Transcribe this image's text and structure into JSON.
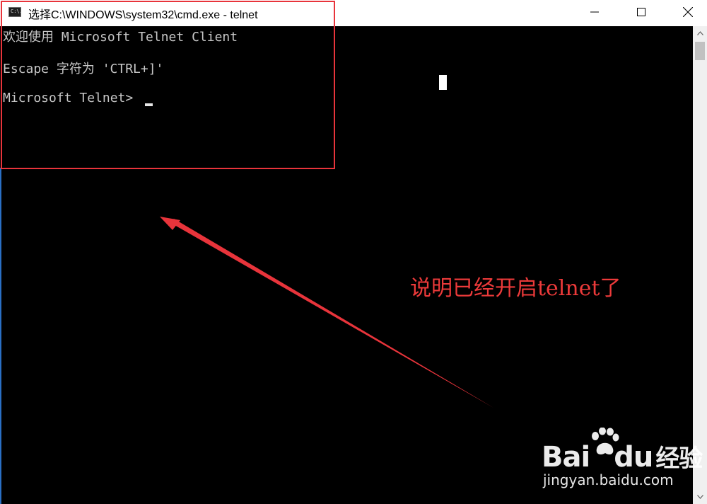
{
  "window": {
    "title": "选择C:\\WINDOWS\\system32\\cmd.exe - telnet",
    "icon": "cmd-icon",
    "icon_text": "C:\\."
  },
  "controls": {
    "minimize_icon": "minimize-icon",
    "maximize_icon": "maximize-icon",
    "close_icon": "close-icon"
  },
  "console": {
    "lines": [
      "欢迎使用 Microsoft Telnet Client",
      "Escape 字符为 'CTRL+]'",
      "Microsoft Telnet> "
    ],
    "background": "#000000",
    "text_color": "#c7c7c7"
  },
  "annotation": {
    "text": "说明已经开启telnet了",
    "color": "#ec3a3a"
  },
  "watermark": {
    "brand": "Bai",
    "brand_suffix": "du",
    "brand_cn": "经验",
    "url": "jingyan.baidu.com"
  }
}
